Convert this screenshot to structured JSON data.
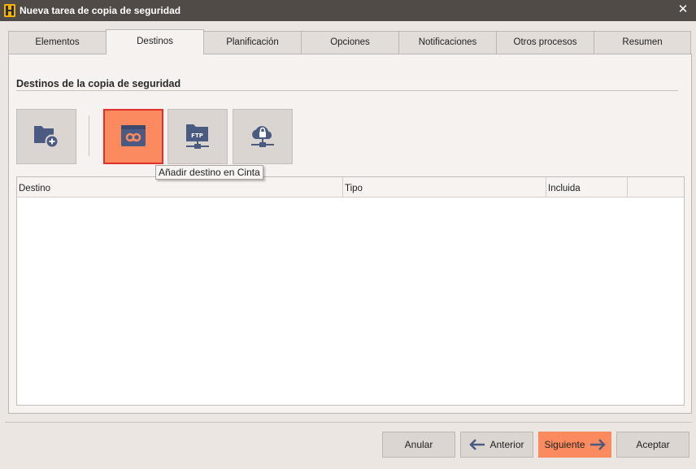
{
  "window": {
    "title": "Nueva tarea de copia de seguridad",
    "close_icon": "close-icon"
  },
  "tabs": [
    {
      "label": "Elementos",
      "active": false
    },
    {
      "label": "Destinos",
      "active": true
    },
    {
      "label": "Planificación",
      "active": false
    },
    {
      "label": "Opciones",
      "active": false
    },
    {
      "label": "Notificaciones",
      "active": false
    },
    {
      "label": "Otros procesos",
      "active": false
    },
    {
      "label": "Resumen",
      "active": false
    }
  ],
  "section": {
    "title": "Destinos de la copia de seguridad"
  },
  "toolbar": {
    "buttons": [
      {
        "icon": "add-folder-icon",
        "active": false
      },
      {
        "icon": "tape-drive-icon",
        "active": true
      },
      {
        "icon": "ftp-folder-icon",
        "active": false
      },
      {
        "icon": "cloud-lock-icon",
        "active": false
      }
    ],
    "tooltip": "Añadir destino en Cinta"
  },
  "grid": {
    "columns": [
      "Destino",
      "Tipo",
      "Incluida"
    ],
    "rows": []
  },
  "footer": {
    "cancel_label": "Anular",
    "back_label": "Anterior",
    "next_label": "Siguiente",
    "accept_label": "Aceptar"
  },
  "colors": {
    "accent": "#fb8b5e",
    "accent_border": "#e0302b",
    "icon": "#4a5a80",
    "titlebar": "#514b48"
  }
}
